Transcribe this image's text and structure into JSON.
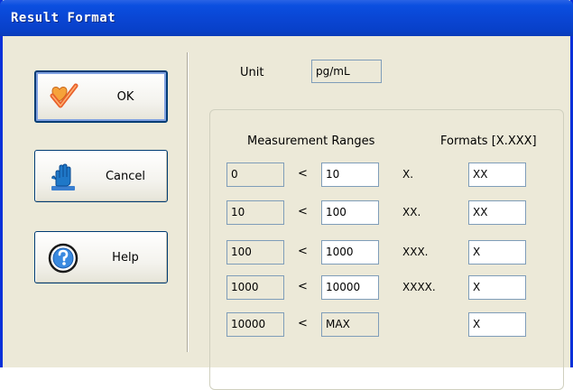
{
  "window": {
    "title": "Result Format"
  },
  "buttons": {
    "ok": {
      "label": "OK",
      "icon": "check-icon"
    },
    "cancel": {
      "label": "Cancel",
      "icon": "hand-icon"
    },
    "help": {
      "label": "Help",
      "icon": "help-icon"
    }
  },
  "unit": {
    "label": "Unit",
    "value": "pg/mL"
  },
  "headers": {
    "ranges": "Measurement Ranges",
    "formats": "Formats [X.XXX]"
  },
  "rows": [
    {
      "lower": "0",
      "op": "<",
      "upper": "10",
      "format_label": "X.",
      "format_value": "XX"
    },
    {
      "lower": "10",
      "op": "<",
      "upper": "100",
      "format_label": "XX.",
      "format_value": "XX"
    },
    {
      "lower": "100",
      "op": "<",
      "upper": "1000",
      "format_label": "XXX.",
      "format_value": "X"
    },
    {
      "lower": "1000",
      "op": "<",
      "upper": "10000",
      "format_label": "XXXX.",
      "format_value": "X"
    },
    {
      "lower": "10000",
      "op": "<",
      "upper": "MAX",
      "format_label": "",
      "format_value": "X"
    }
  ],
  "colors": {
    "titlebar": "#0a46d4",
    "face": "#ece9d8",
    "field_border": "#7f9db9"
  }
}
